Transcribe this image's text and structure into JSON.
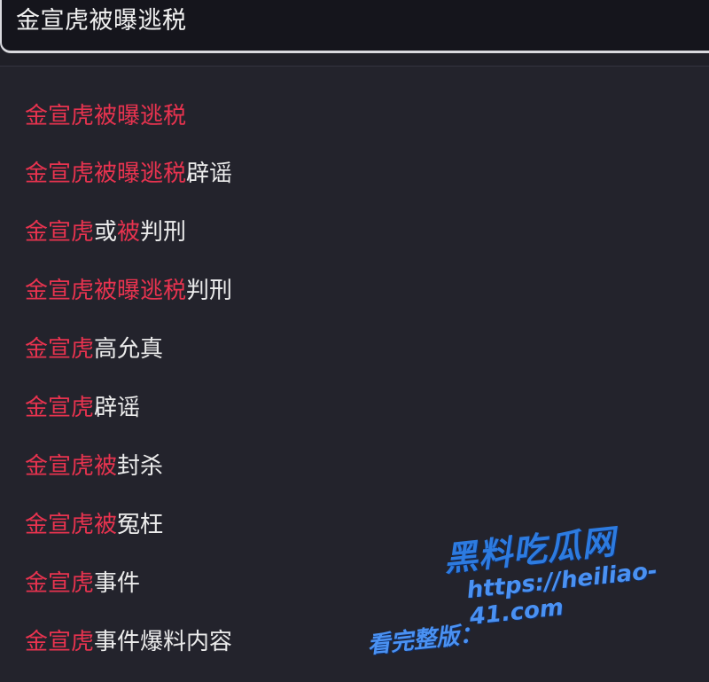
{
  "search": {
    "query": "金宣虎被曝逃税"
  },
  "suggestions": [
    {
      "highlight": "金宣虎被曝逃税",
      "rest": ""
    },
    {
      "highlight": "金宣虎被曝逃税",
      "rest": "辟谣"
    },
    {
      "highlight": "金宣虎",
      "mid": "或",
      "highlight2": "被",
      "rest": "判刑"
    },
    {
      "highlight": "金宣虎被曝逃税",
      "rest": "判刑"
    },
    {
      "highlight": "金宣虎",
      "rest": "高允真"
    },
    {
      "highlight": "金宣虎",
      "rest": "辟谣"
    },
    {
      "highlight": "金宣虎被",
      "rest": "封杀"
    },
    {
      "highlight": "金宣虎被",
      "rest": "冤枉"
    },
    {
      "highlight": "金宣虎",
      "rest": "事件"
    },
    {
      "highlight": "金宣虎",
      "rest": "事件爆料内容"
    }
  ],
  "watermark": {
    "logo": "黑料吃瓜网",
    "prefix": "看完整版：",
    "url": "https://heiliao-41.com"
  },
  "colors": {
    "highlight": "#e8334f",
    "text": "#ececec",
    "background": "#23232c"
  }
}
